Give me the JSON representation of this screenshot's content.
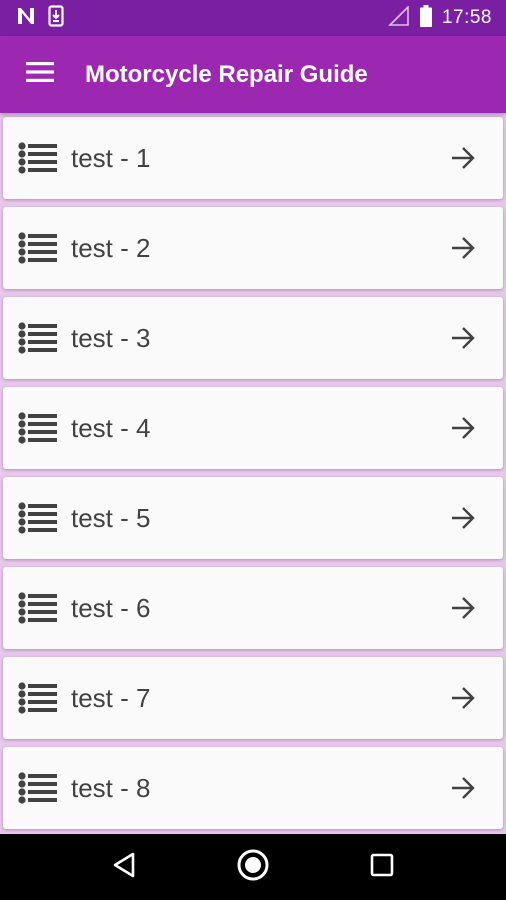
{
  "status_bar": {
    "time": "17:58",
    "icons": [
      "n-notification-icon",
      "download-notification-icon",
      "signal-icon",
      "battery-icon"
    ]
  },
  "app_bar": {
    "title": "Motorcycle Repair Guide",
    "menu_icon": "hamburger-menu-icon"
  },
  "list": {
    "items": [
      {
        "label": "test - 1"
      },
      {
        "label": "test - 2"
      },
      {
        "label": "test - 3"
      },
      {
        "label": "test - 4"
      },
      {
        "label": "test - 5"
      },
      {
        "label": "test - 6"
      },
      {
        "label": "test - 7"
      },
      {
        "label": "test - 8"
      }
    ],
    "item_icon": "list-bullet-icon",
    "item_action_icon": "arrow-right-icon"
  },
  "nav_bar": {
    "buttons": [
      "back-icon",
      "home-icon",
      "recents-icon"
    ]
  },
  "colors": {
    "status_bar": "#7b1fa2",
    "app_bar": "#9c27b0",
    "background": "#e8c7ec",
    "card": "#fafafa",
    "text": "#424242"
  }
}
